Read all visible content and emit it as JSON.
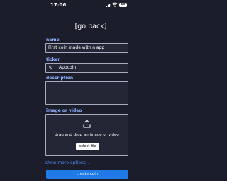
{
  "status_bar": {
    "time": "17:06",
    "battery_level": "59"
  },
  "header": {
    "back_label": "[go back]"
  },
  "form": {
    "name": {
      "label": "name",
      "value": "First coin made within app"
    },
    "ticker": {
      "label": "ticker",
      "prefix": "$",
      "value": "Appcoin"
    },
    "description": {
      "label": "description",
      "value": ""
    },
    "media": {
      "label": "image or video",
      "drop_text": "drag and drop an image or video",
      "select_button_label": "select file",
      "icon": "upload-icon"
    },
    "show_more_label": "show more options ↓",
    "submit_label": "create coin"
  },
  "colors": {
    "background": "#1b1d2b",
    "label": "#8fb3ff",
    "link": "#4f8df7",
    "primary_button": "#1f7ae8"
  }
}
